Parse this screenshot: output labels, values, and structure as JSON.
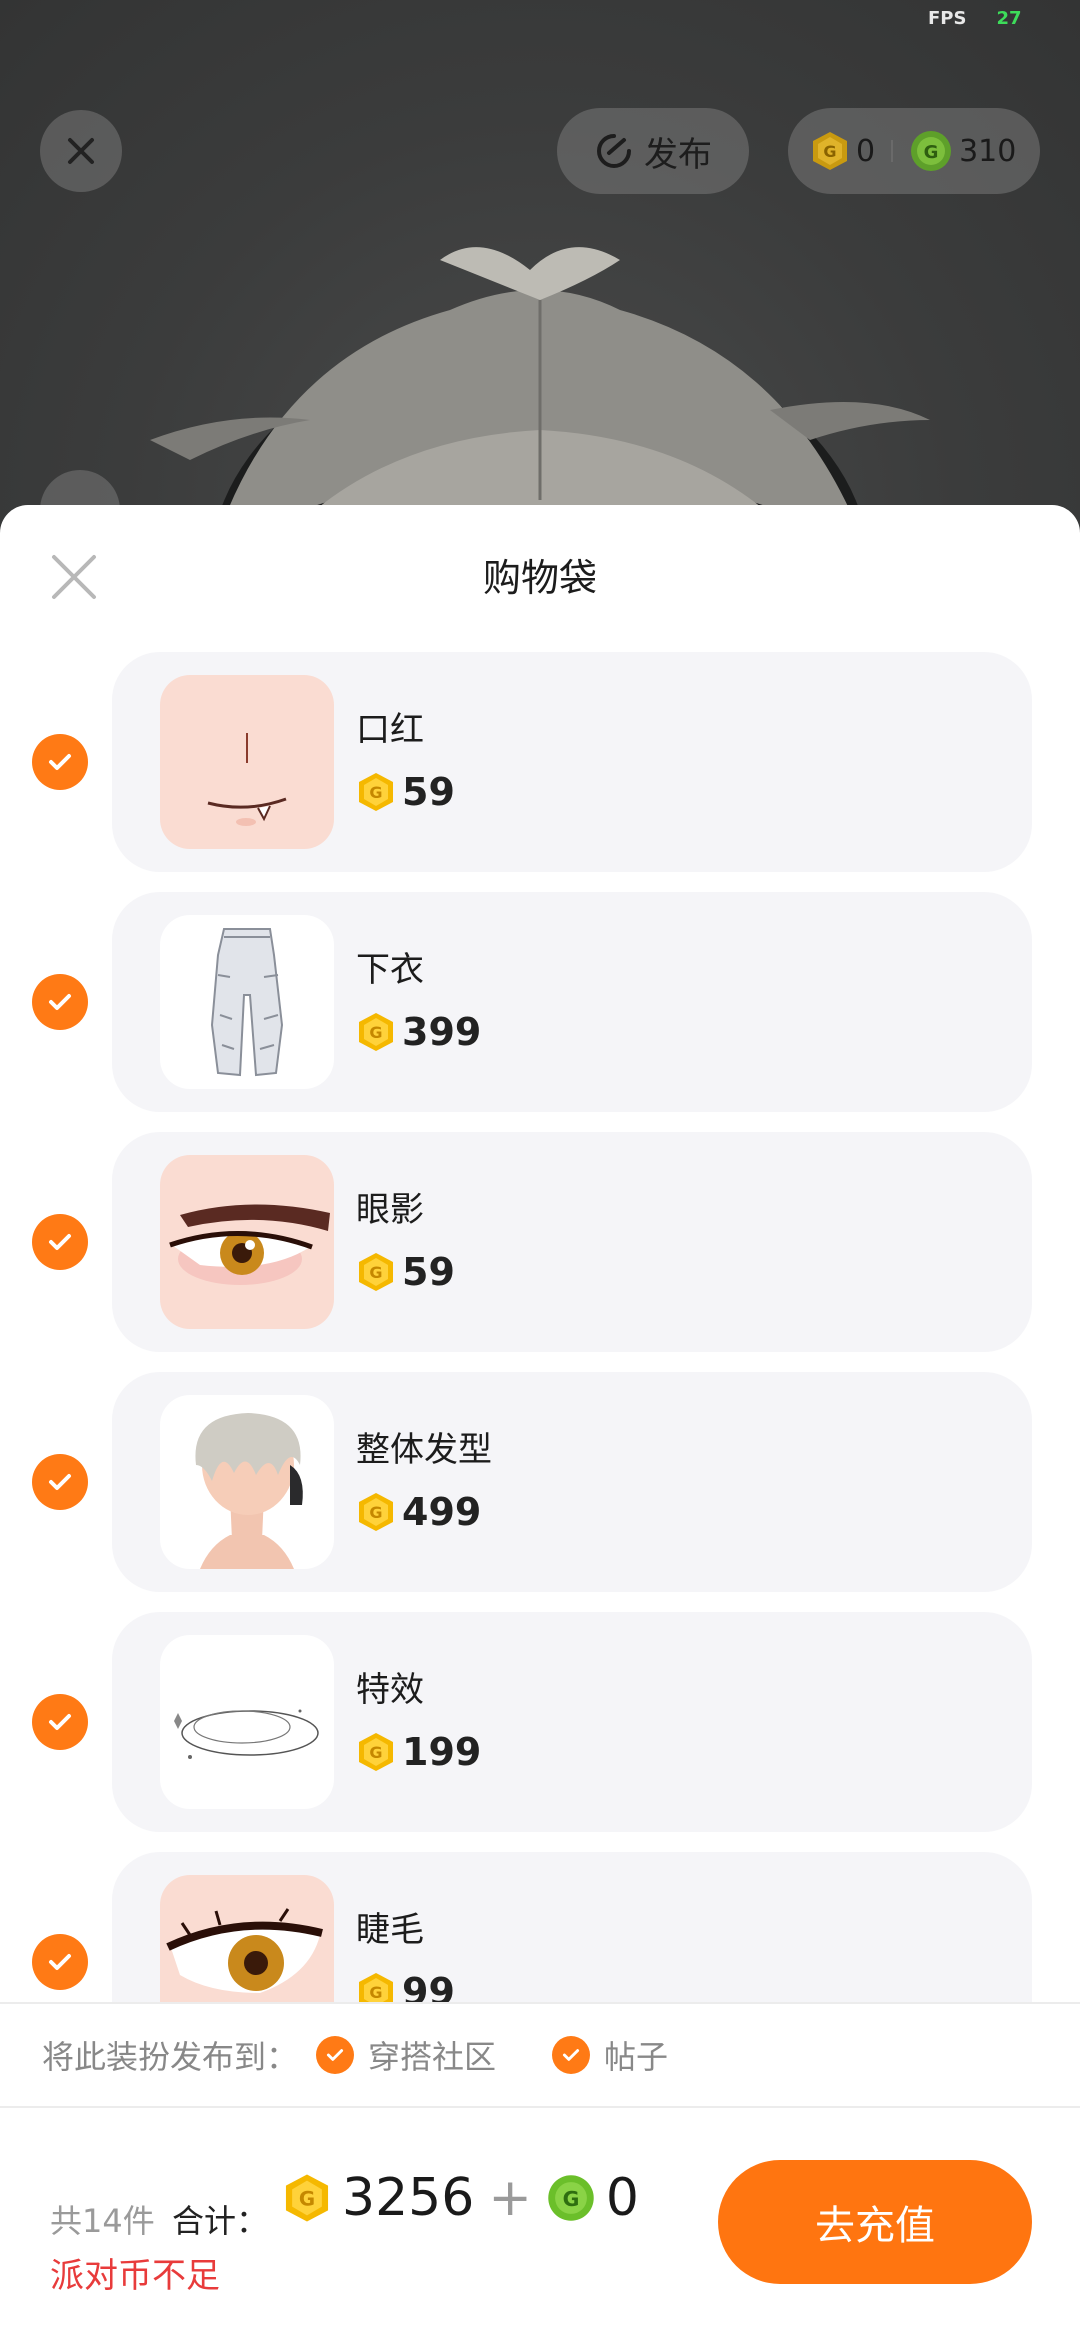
{
  "status": {
    "fps_label": "FPS",
    "fps_value": "27"
  },
  "top_bar": {
    "publish_label": "发布",
    "gold_balance": "0",
    "green_balance": "310"
  },
  "sheet": {
    "title": "购物袋",
    "items": [
      {
        "name": "口红",
        "price": "59",
        "thumb": "lips"
      },
      {
        "name": "下衣",
        "price": "399",
        "thumb": "pants"
      },
      {
        "name": "眼影",
        "price": "59",
        "thumb": "eye"
      },
      {
        "name": "整体发型",
        "price": "499",
        "thumb": "hair"
      },
      {
        "name": "特效",
        "price": "199",
        "thumb": "effect"
      },
      {
        "name": "睫毛",
        "price": "99",
        "thumb": "lash"
      }
    ]
  },
  "publish_to": {
    "label": "将此装扮发布到：",
    "options": [
      {
        "label": "穿搭社区"
      },
      {
        "label": "帖子"
      }
    ]
  },
  "footer": {
    "count": "共14件",
    "total_label": "合计：",
    "gold_total": "3256",
    "plus": "+",
    "green_total": "0",
    "warning": "派对币不足",
    "recharge_label": "去充值"
  },
  "colors": {
    "accent": "#ff7a15",
    "warning": "#e83b3b",
    "gold": "#f5b800",
    "green": "#6bbf2a"
  }
}
